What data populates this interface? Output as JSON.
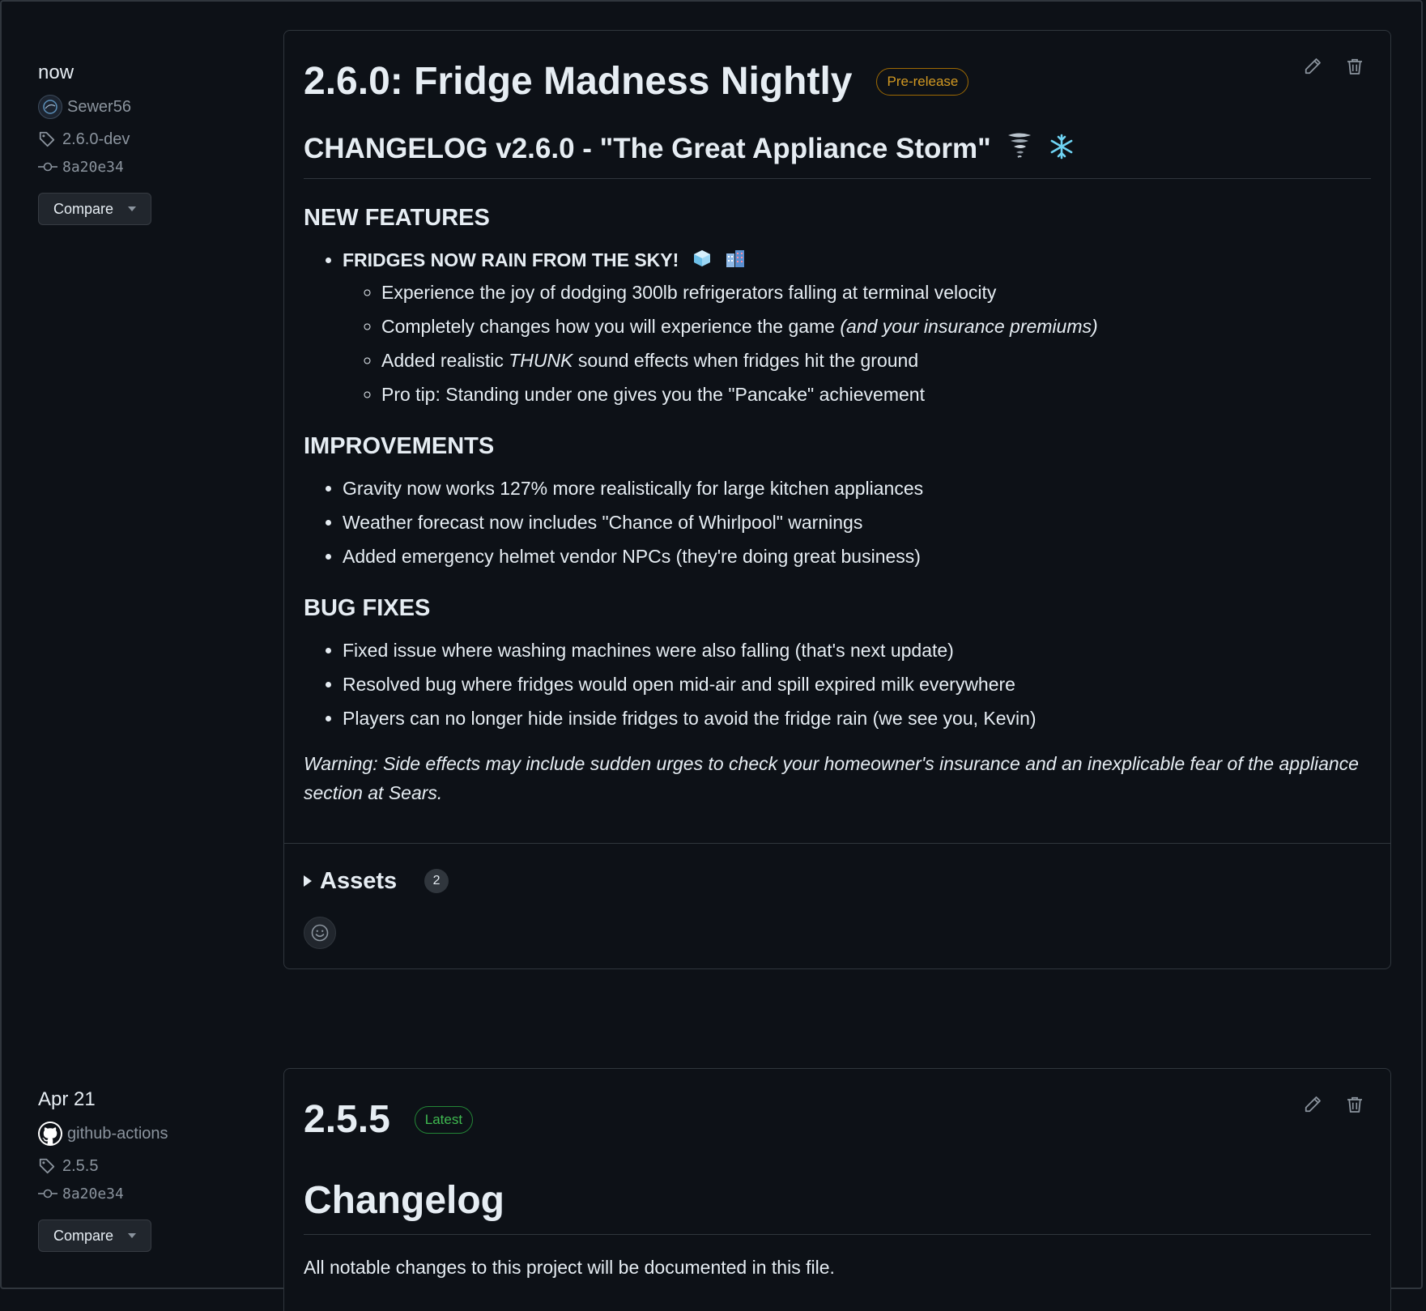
{
  "releases": [
    {
      "when": "now",
      "author": "Sewer56",
      "author_avatar": "avatar",
      "tag": "2.6.0-dev",
      "commit": "8a20e34",
      "compare_label": "Compare",
      "title": "2.6.0: Fridge Madness Nightly",
      "badge": "Pre-release",
      "body": {
        "heading": "CHANGELOG v2.6.0 - \"The Great Appliance Storm\"",
        "heading_icons": [
          "tornado-icon",
          "snowflake-icon"
        ],
        "new_features": {
          "title": "NEW FEATURES",
          "lead": "FRIDGES NOW RAIN FROM THE SKY!",
          "lead_icons": [
            "ice-cube-icon",
            "building-icon"
          ],
          "sub_1": "Experience the joy of dodging 300lb refrigerators falling at terminal velocity",
          "sub_2_a": "Completely changes how you will experience the game ",
          "sub_2_b": "(and your insurance premiums)",
          "sub_3_a": "Added realistic ",
          "sub_3_b": "THUNK",
          "sub_3_c": " sound effects when fridges hit the ground",
          "sub_4": "Pro tip: Standing under one gives you the \"Pancake\" achievement"
        },
        "improvements": {
          "title": "IMPROVEMENTS",
          "items": [
            "Gravity now works 127% more realistically for large kitchen appliances",
            "Weather forecast now includes \"Chance of Whirlpool\" warnings",
            "Added emergency helmet vendor NPCs (they're doing great business)"
          ]
        },
        "bug_fixes": {
          "title": "BUG FIXES",
          "items": [
            "Fixed issue where washing machines were also falling (that's next update)",
            "Resolved bug where fridges would open mid-air and spill expired milk everywhere",
            "Players can no longer hide inside fridges to avoid the fridge rain (we see you, Kevin)"
          ]
        },
        "warning": "Warning: Side effects may include sudden urges to check your homeowner's insurance and an inexplicable fear of the appliance section at Sears."
      },
      "assets_label": "Assets",
      "assets_count": "2"
    },
    {
      "when": "Apr 21",
      "author": "github-actions",
      "author_avatar": "github-mark-icon",
      "tag": "2.5.5",
      "commit": "8a20e34",
      "compare_label": "Compare",
      "title": "2.5.5",
      "badge": "Latest",
      "body": {
        "heading": "Changelog",
        "intro": "All notable changes to this project will be documented in this file."
      }
    }
  ],
  "colors": {
    "background": "#0d1117",
    "border": "#30363d",
    "prerelease": "#d29922",
    "latest": "#3fb950",
    "muted": "#8b949e"
  }
}
